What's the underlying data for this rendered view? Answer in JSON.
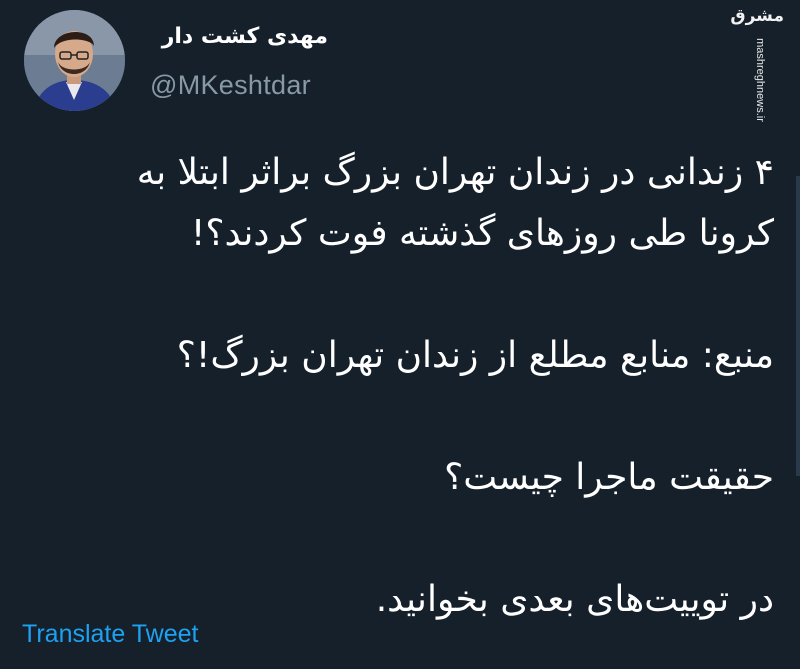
{
  "author": {
    "display_name": "مهدی کشت دار",
    "handle": "@MKeshtdar",
    "avatar_icon": "profile-photo"
  },
  "watermark": {
    "logo_text": "مشرق",
    "url": "mashreghnews.ir"
  },
  "tweet": {
    "lines": [
      "۴ زندانی در زندان تهران بزرگ براثر ابتلا به",
      "کرونا طی روزهای گذشته فوت کردند؟!",
      "منبع: منابع مطلع از زندان تهران بزرگ!؟",
      "حقیقت ماجرا چیست؟",
      "در توییت‌های بعدی بخوانید."
    ]
  },
  "actions": {
    "translate_label": "Translate Tweet"
  },
  "colors": {
    "background": "#15202b",
    "text": "#ffffff",
    "secondary": "#8899a6",
    "link": "#1da1f2"
  }
}
